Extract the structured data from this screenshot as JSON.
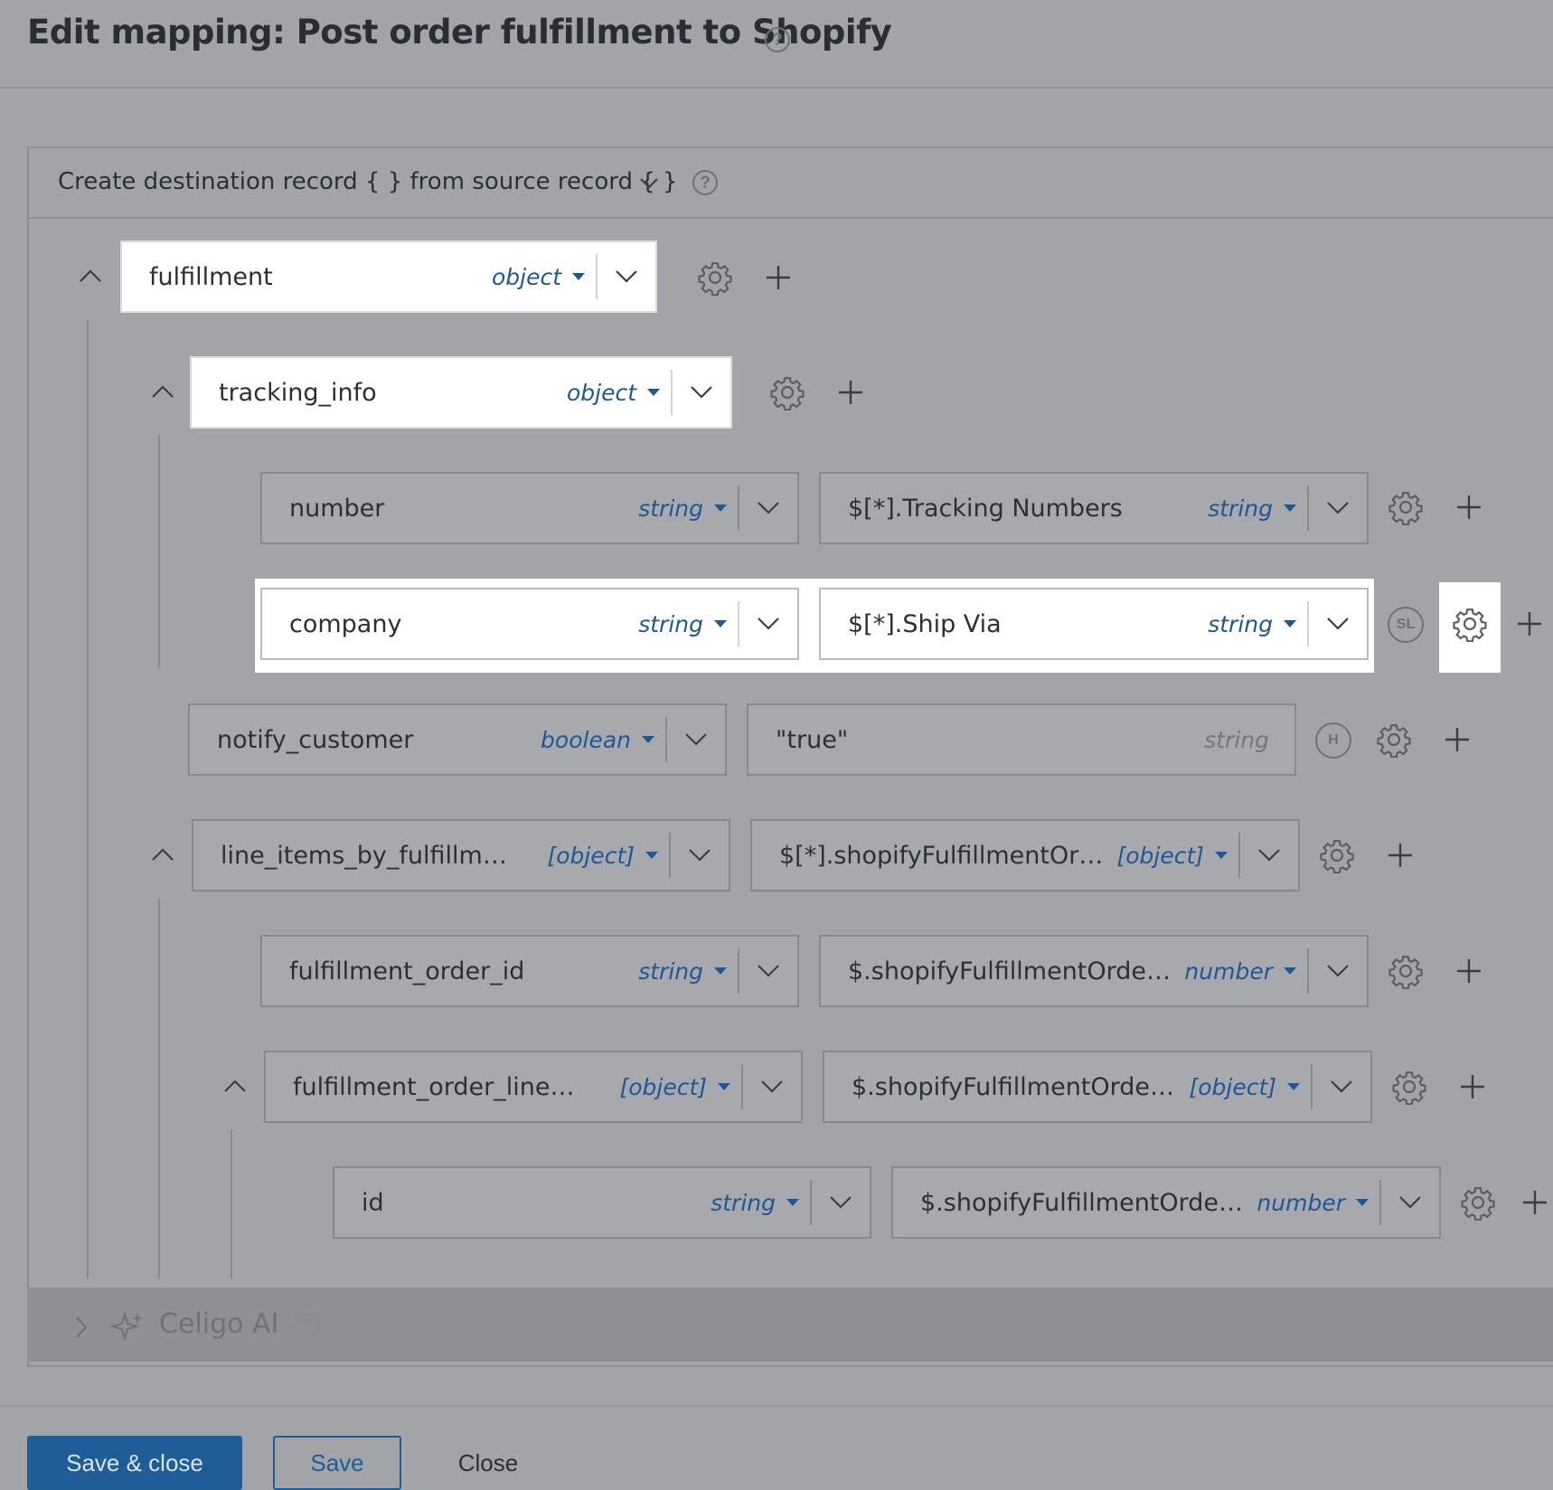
{
  "header": {
    "title": "Edit mapping: Post order fulfillment to Shopify"
  },
  "rule": {
    "label": "Create destination record { } from source record { }"
  },
  "rows": {
    "fulfillment": {
      "dest": "fulfillment",
      "dest_type": "object"
    },
    "tracking_info": {
      "dest": "tracking_info",
      "dest_type": "object"
    },
    "number": {
      "dest": "number",
      "dest_type": "string",
      "src": "$[*].Tracking Numbers",
      "src_type": "string"
    },
    "company": {
      "dest": "company",
      "dest_type": "string",
      "src": "$[*].Ship Via",
      "src_type": "string",
      "badge": "SL"
    },
    "notify_customer": {
      "dest": "notify_customer",
      "dest_type": "boolean",
      "src": "\"true\"",
      "src_type": "string",
      "badge": "H"
    },
    "line_items": {
      "dest": "line_items_by_fulfillm…",
      "dest_type": "[object]",
      "src": "$[*].shopifyFulfillmentOr…",
      "src_type": "[object]"
    },
    "fulfillment_order_id": {
      "dest": "fulfillment_order_id",
      "dest_type": "string",
      "src": "$.shopifyFulfillmentOrde…",
      "src_type": "number"
    },
    "fulfillment_order_line": {
      "dest": "fulfillment_order_line…",
      "dest_type": "[object]",
      "src": "$.shopifyFulfillmentOrde…",
      "src_type": "[object]"
    },
    "id": {
      "dest": "id",
      "dest_type": "string",
      "src": "$.shopifyFulfillmentOrde…",
      "src_type": "number"
    }
  },
  "ai": {
    "label": "Celigo AI"
  },
  "footer": {
    "save_close": "Save & close",
    "save": "Save",
    "close": "Close"
  },
  "colors": {
    "accent": "#1f5d98",
    "type_text": "#1d5896",
    "overlay_bg": "#a3a4a8"
  }
}
